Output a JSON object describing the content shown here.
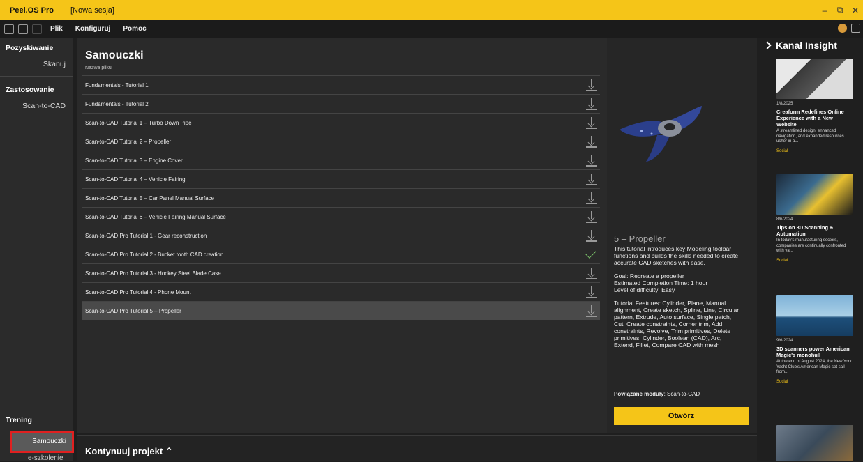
{
  "titlebar": {
    "app_name": "Peel.OS Pro",
    "session": "[Nowa sesja]",
    "minimize": "–",
    "maximize": "⧉",
    "close": "✕"
  },
  "menubar": {
    "file": "Plik",
    "configure": "Konfiguruj",
    "help": "Pomoc"
  },
  "sidebar": {
    "acquire_head": "Pozyskiwanie",
    "scan": "Skanuj",
    "apply_head": "Zastosowanie",
    "scan_to_cad": "Scan-to-CAD",
    "training_head": "Trening",
    "tutorials": "Samouczki",
    "elearning": "e-szkolenie"
  },
  "main": {
    "title": "Samouczki",
    "column_header": "Nazwa pliku",
    "rows": [
      {
        "name": "Fundamentals - Tutorial 1",
        "status": "download"
      },
      {
        "name": "Fundamentals - Tutorial 2",
        "status": "download"
      },
      {
        "name": "Scan-to-CAD Tutorial 1 – Turbo Down Pipe",
        "status": "download"
      },
      {
        "name": "Scan-to-CAD Tutorial 2 – Propeller",
        "status": "download"
      },
      {
        "name": "Scan-to-CAD Tutorial 3 – Engine Cover",
        "status": "download"
      },
      {
        "name": "Scan-to-CAD Tutorial 4 – Vehicle Fairing",
        "status": "download"
      },
      {
        "name": "Scan-to-CAD Tutorial 5 – Car Panel Manual Surface",
        "status": "download"
      },
      {
        "name": "Scan-to-CAD Tutorial 6 – Vehicle Fairing Manual Surface",
        "status": "download"
      },
      {
        "name": "Scan-to-CAD Pro Tutorial 1 - Gear reconstruction",
        "status": "download"
      },
      {
        "name": "Scan-to-CAD Pro Tutorial 2 - Bucket tooth CAD creation",
        "status": "done"
      },
      {
        "name": "Scan-to-CAD Pro Tutorial 3 - Hockey Steel Blade Case",
        "status": "download"
      },
      {
        "name": "Scan-to-CAD Pro Tutorial 4 - Phone Mount",
        "status": "download"
      },
      {
        "name": "Scan-to-CAD Pro Tutorial 5 – Propeller",
        "status": "download",
        "selected": true
      }
    ]
  },
  "detail": {
    "title": "5 – Propeller",
    "intro": "This tutorial introduces key Modeling toolbar functions and builds the skills needed to create accurate CAD sketches with ease.",
    "goal": "Goal: Recreate a propeller",
    "time": "Estimated Completion Time: 1 hour",
    "level": "Level of difficulty: Easy",
    "features": "Tutorial Features: Cylinder, Plane, Manual alignment, Create sketch, Spline, Line, Circular pattern, Extrude, Auto surface, Single patch, Cut, Create constraints, Corner trim, Add constraints, Revolve, Trim primitives, Delete primitives, Cylinder, Boolean (CAD), Arc, Extend, Fillet, Compare CAD with mesh",
    "modules_label": "Powiązane moduły",
    "modules_value": ": Scan-to-CAD",
    "open_button": "Otwórz"
  },
  "bottom": {
    "continue_label": "Kontynuuj projekt ⌃"
  },
  "insight": {
    "title": "Kanał Insight",
    "cards": [
      {
        "date": "1/8/2025",
        "title": "Creaform Redefines Online Experience with a New Website",
        "desc": "A streamlined design, enhanced navigation, and expanded resources usher in a...",
        "tag": "Social"
      },
      {
        "date": "8/6/2024",
        "title": "Tips on 3D Scanning & Automation",
        "desc": "In today's manufacturing sectors, companies are continually confronted with va...",
        "tag": "Social"
      },
      {
        "date": "9/6/2024",
        "title": "3D scanners power American Magic's monohull",
        "desc": "At the end of August 2024, the New York Yacht Club's American Magic set sail from...",
        "tag": "Social"
      }
    ]
  }
}
